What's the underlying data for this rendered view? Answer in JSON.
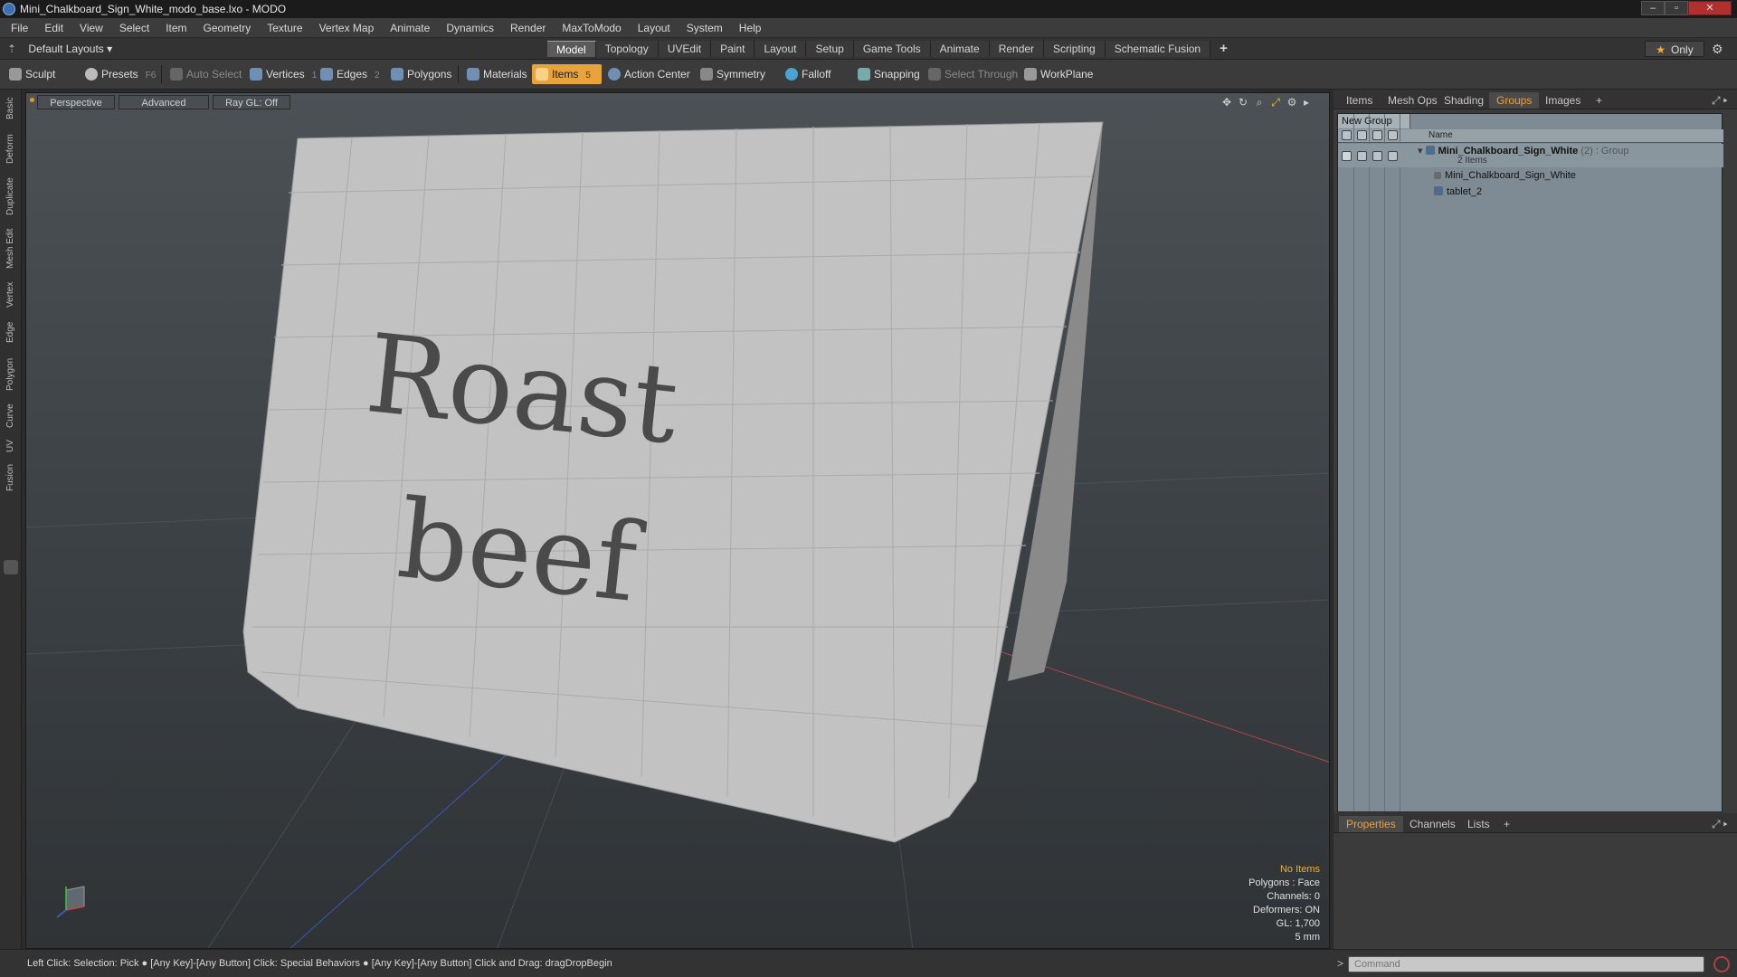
{
  "window": {
    "title": "Mini_Chalkboard_Sign_White_modo_base.lxo - MODO",
    "controls": [
      "–",
      "▫",
      "✕"
    ]
  },
  "menu": [
    "File",
    "Edit",
    "View",
    "Select",
    "Item",
    "Geometry",
    "Texture",
    "Vertex Map",
    "Animate",
    "Dynamics",
    "Render",
    "MaxToModo",
    "Layout",
    "System",
    "Help"
  ],
  "layout_bar": {
    "layout_select": "Default Layouts",
    "tabs": [
      "Model",
      "Topology",
      "UVEdit",
      "Paint",
      "Layout",
      "Setup",
      "Game Tools",
      "Animate",
      "Render",
      "Scripting",
      "Schematic Fusion"
    ],
    "active_tab": "Model",
    "add": "+",
    "only": "Only"
  },
  "toolbar": {
    "sculpt": "Sculpt",
    "presets": "Presets",
    "presets_key": "F6",
    "auto_select": "Auto Select",
    "vertices": "Vertices",
    "vertices_count": "1",
    "edges": "Edges",
    "edges_count": "2",
    "polygons": "Polygons",
    "materials": "Materials",
    "items": "Items",
    "items_count": "5",
    "action_center": "Action Center",
    "symmetry": "Symmetry",
    "falloff": "Falloff",
    "snapping": "Snapping",
    "select_through": "Select Through",
    "workplane": "WorkPlane"
  },
  "left_tabs": [
    "Basic",
    "Deform",
    "Duplicate",
    "Mesh Edit",
    "Vertex",
    "Edge",
    "Polygon",
    "Curve",
    "UV",
    "Fusion"
  ],
  "viewport": {
    "view_mode": "Perspective",
    "shading": "Advanced",
    "raygl": "Ray GL: Off",
    "sign_text_line1": "Roast",
    "sign_text_line2": "beef",
    "info": {
      "selection": "No Items",
      "polygons": "Polygons : Face",
      "channels": "Channels: 0",
      "deformers": "Deformers: ON",
      "gl": "GL: 1,700",
      "scale": "5 mm"
    }
  },
  "right_panel": {
    "tabs": [
      "Items",
      "Mesh Ops",
      "Shading",
      "Groups",
      "Images"
    ],
    "active_tab": "Groups",
    "new_group": "New Group",
    "column_name": "Name",
    "group": {
      "name": "Mini_Chalkboard_Sign_White",
      "suffix": "(2) : Group",
      "count": "2 Items",
      "children": [
        "Mini_Chalkboard_Sign_White",
        "tablet_2"
      ]
    },
    "bottom_tabs": [
      "Properties",
      "Channels",
      "Lists"
    ],
    "bottom_active": "Properties"
  },
  "status": {
    "text": "Left Click: Selection: Pick ● [Any Key]-[Any Button] Click: Special Behaviors ● [Any Key]-[Any Button] Click and Drag: dragDropBegin"
  },
  "command": {
    "placeholder": "Command",
    "prompt": ">"
  },
  "colors": {
    "accent": "#e8a33a",
    "active_tab_text": "#f0a030",
    "viewport_bg": "#3e4347",
    "sign_surface": "#c4c4c4",
    "chalk_text": "#4a4a4a"
  }
}
